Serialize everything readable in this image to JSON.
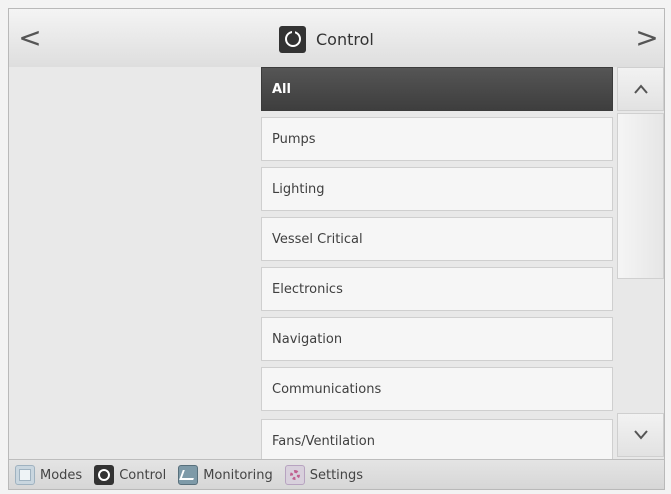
{
  "header": {
    "back_glyph": "<",
    "forward_glyph": ">",
    "title": "Control",
    "title_icon": "control-logo-icon"
  },
  "categories": {
    "items": [
      {
        "label": "All",
        "selected": true
      },
      {
        "label": "Pumps",
        "selected": false
      },
      {
        "label": "Lighting",
        "selected": false
      },
      {
        "label": "Vessel Critical",
        "selected": false
      },
      {
        "label": "Electronics",
        "selected": false
      },
      {
        "label": "Navigation",
        "selected": false
      },
      {
        "label": "Communications",
        "selected": false
      },
      {
        "label": "Fans/Ventilation",
        "selected": false
      }
    ]
  },
  "scroll": {
    "up_glyph": "^",
    "down_glyph": "v"
  },
  "bottom_nav": {
    "tabs": [
      {
        "label": "Modes",
        "icon": "modes-icon"
      },
      {
        "label": "Control",
        "icon": "control-icon"
      },
      {
        "label": "Monitoring",
        "icon": "monitoring-icon"
      },
      {
        "label": "Settings",
        "icon": "settings-icon"
      }
    ]
  },
  "colors": {
    "selected_bg": "#444444",
    "item_bg": "#f6f6f6",
    "background": "#ebebeb"
  }
}
